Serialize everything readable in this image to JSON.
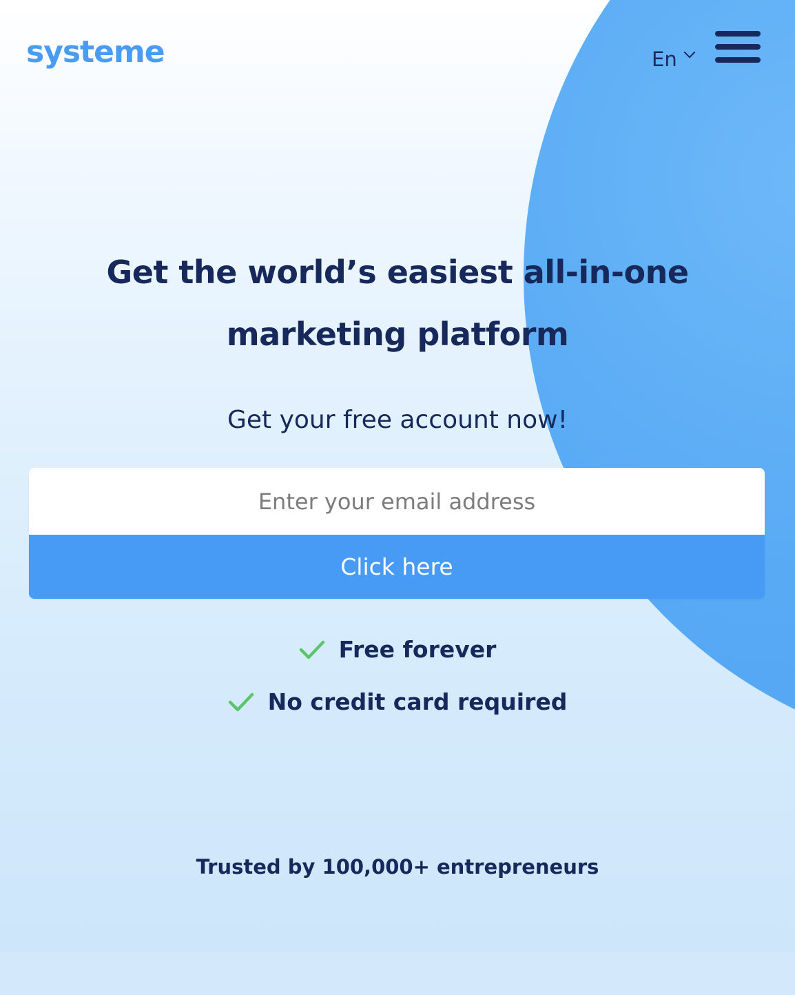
{
  "header": {
    "logo_text": "systeme",
    "language": "En",
    "menu_icon": "hamburger-menu-icon"
  },
  "hero": {
    "headline": "Get the world’s easiest all-in-one marketing platform",
    "subhead": "Get your free account now!"
  },
  "form": {
    "email_placeholder": "Enter your email address",
    "email_value": "",
    "submit_label": "Click here"
  },
  "features": [
    {
      "icon": "check-icon",
      "text": "Free forever"
    },
    {
      "icon": "check-icon",
      "text": "No credit card required"
    }
  ],
  "trusted_text": "Trusted by 100,000+ entrepreneurs",
  "colors": {
    "brand_blue": "#4a9cf3",
    "button_blue": "#479bf5",
    "navy_text": "#17295b",
    "check_green": "#5cc56b",
    "circle_blue": "#58aaf5"
  }
}
